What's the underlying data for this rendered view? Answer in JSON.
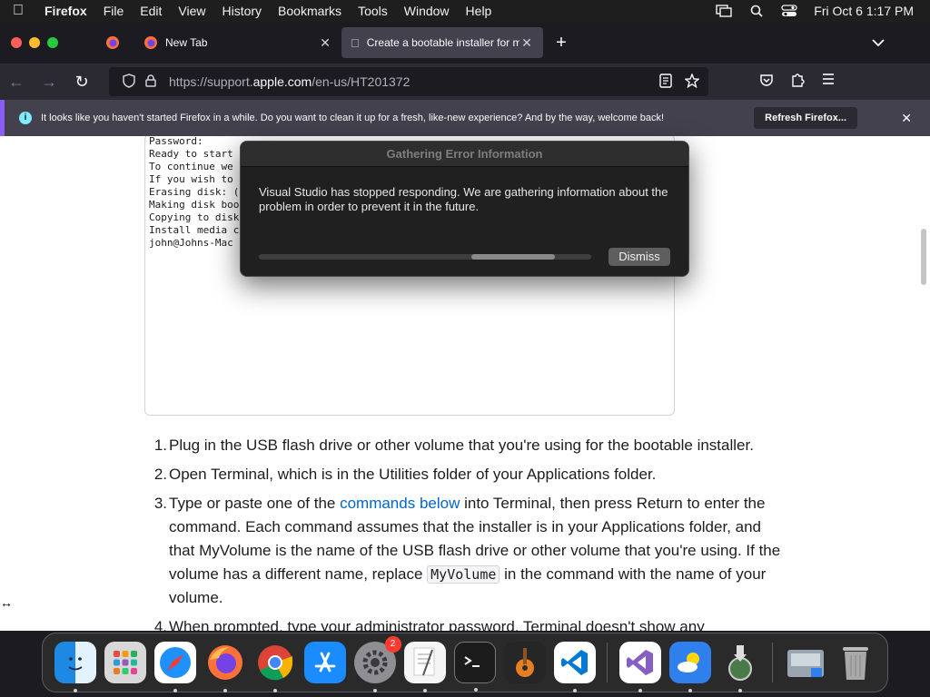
{
  "menubar": {
    "app_name": "Firefox",
    "items": [
      "File",
      "Edit",
      "View",
      "History",
      "Bookmarks",
      "Tools",
      "Window",
      "Help"
    ],
    "clock": "Fri Oct 6  1:17 PM"
  },
  "tabs": {
    "newtab_label": "New Tab",
    "active_label": "Create a bootable installer for m"
  },
  "urlbar": {
    "url_prefix": "https://support.",
    "url_domain": "apple.com",
    "url_path": "/en-us/HT201372"
  },
  "notification": {
    "message": "It looks like you haven't started Firefox in a while. Do you want to clean it up for a fresh, like-new experience? And by the way, welcome back!",
    "button_label": "Refresh Firefox..."
  },
  "terminal": {
    "lines": [
      "Password:",
      "Ready to start",
      "To continue we",
      "If you wish to",
      "Erasing disk: (",
      "Making disk boo",
      "Copying to disk",
      "Install media c",
      "john@Johns-Mac"
    ]
  },
  "steps": {
    "step1_num": "1.",
    "step1": "Plug in the USB flash drive or other volume that you're using for the bootable installer.",
    "step2_num": "2.",
    "step2": "Open Terminal, which is in the Utilities folder of your Applications folder.",
    "step3_num": "3.",
    "step3_a": "Type or paste one of the ",
    "step3_link": "commands below",
    "step3_b": " into Terminal, then press Return to enter the command. Each command assumes that the installer is in your Applications folder, and that MyVolume is the name of the USB flash drive or other volume that you're using. If the volume has a different name, replace ",
    "step3_code": "MyVolume",
    "step3_c": " in the command with the name of your volume.",
    "step4_num": "4.",
    "step4": "When prompted, type your administrator password. Terminal doesn't show any"
  },
  "dialog": {
    "title": "Gathering Error Information",
    "message": "Visual Studio has stopped responding. We are gathering information about the problem in order to prevent it in the future.",
    "dismiss_label": "Dismiss",
    "progress_start": 0.64,
    "progress_end": 0.89
  },
  "dock": {
    "settings_badge": "2"
  },
  "colors": {
    "accent_link": "#0066cc",
    "firefox_bg": "#1c1b22",
    "notice_accent": "#8b5cf6"
  }
}
